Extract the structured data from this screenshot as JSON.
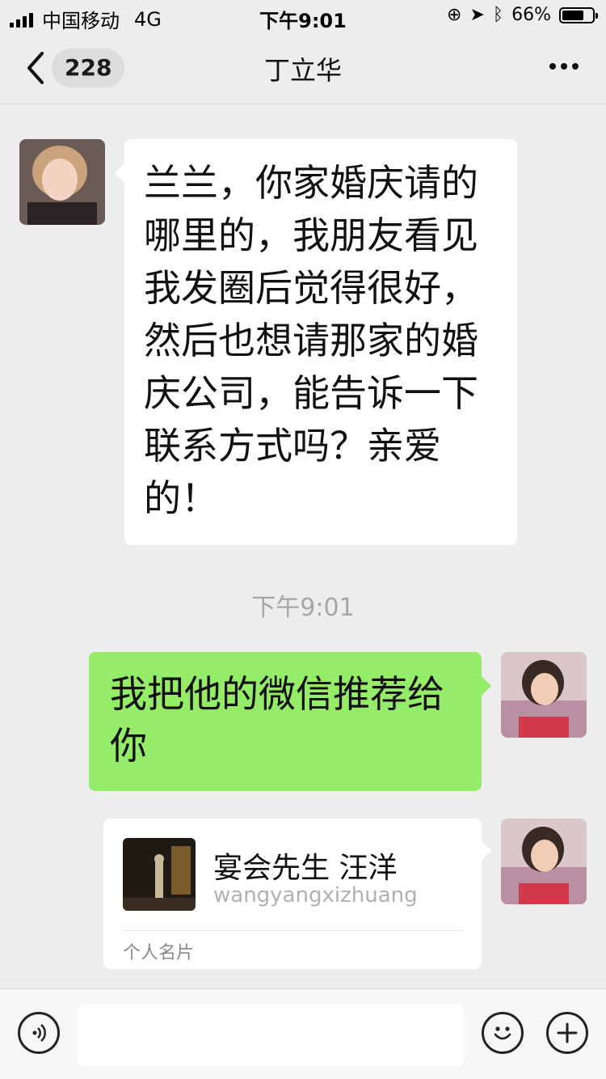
{
  "status_bar": {
    "carrier": "中国移动",
    "network": "4G",
    "time": "下午9:01",
    "battery": "66%",
    "battery_level": 0.66
  },
  "nav": {
    "back_count": "228",
    "title": "丁立华"
  },
  "messages": [
    {
      "side": "received",
      "text": "兰兰，你家婚庆请的哪里的，我朋友看见我发圈后觉得很好，然后也想请那家的婚庆公司，能告诉一下联系方式吗？亲爱的！"
    },
    {
      "timestamp": "下午9:01"
    },
    {
      "side": "sent",
      "text": "我把他的微信推荐给你"
    },
    {
      "side": "sent",
      "type": "contact_card",
      "card_name": "宴会先生  汪洋",
      "card_id": "wangyangxizhuang",
      "card_label": "个人名片"
    }
  ],
  "input_bar": {
    "voice_icon": "voice-icon",
    "emoji_icon": "emoji-icon",
    "plus_icon": "plus-icon"
  },
  "colors": {
    "background": "#ededed",
    "sent_bubble": "#95ec69",
    "received_bubble": "#ffffff"
  }
}
